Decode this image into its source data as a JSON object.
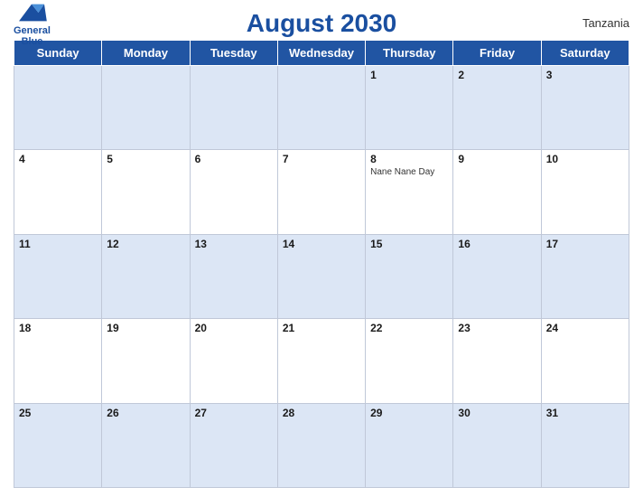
{
  "header": {
    "title": "August 2030",
    "country": "Tanzania",
    "logo_line1": "General",
    "logo_line2": "Blue"
  },
  "days_of_week": [
    "Sunday",
    "Monday",
    "Tuesday",
    "Wednesday",
    "Thursday",
    "Friday",
    "Saturday"
  ],
  "weeks": [
    [
      {
        "day": "",
        "events": []
      },
      {
        "day": "",
        "events": []
      },
      {
        "day": "",
        "events": []
      },
      {
        "day": "",
        "events": []
      },
      {
        "day": "1",
        "events": []
      },
      {
        "day": "2",
        "events": []
      },
      {
        "day": "3",
        "events": []
      }
    ],
    [
      {
        "day": "4",
        "events": []
      },
      {
        "day": "5",
        "events": []
      },
      {
        "day": "6",
        "events": []
      },
      {
        "day": "7",
        "events": []
      },
      {
        "day": "8",
        "events": [
          "Nane Nane Day"
        ]
      },
      {
        "day": "9",
        "events": []
      },
      {
        "day": "10",
        "events": []
      }
    ],
    [
      {
        "day": "11",
        "events": []
      },
      {
        "day": "12",
        "events": []
      },
      {
        "day": "13",
        "events": []
      },
      {
        "day": "14",
        "events": []
      },
      {
        "day": "15",
        "events": []
      },
      {
        "day": "16",
        "events": []
      },
      {
        "day": "17",
        "events": []
      }
    ],
    [
      {
        "day": "18",
        "events": []
      },
      {
        "day": "19",
        "events": []
      },
      {
        "day": "20",
        "events": []
      },
      {
        "day": "21",
        "events": []
      },
      {
        "day": "22",
        "events": []
      },
      {
        "day": "23",
        "events": []
      },
      {
        "day": "24",
        "events": []
      }
    ],
    [
      {
        "day": "25",
        "events": []
      },
      {
        "day": "26",
        "events": []
      },
      {
        "day": "27",
        "events": []
      },
      {
        "day": "28",
        "events": []
      },
      {
        "day": "29",
        "events": []
      },
      {
        "day": "30",
        "events": []
      },
      {
        "day": "31",
        "events": []
      }
    ]
  ]
}
